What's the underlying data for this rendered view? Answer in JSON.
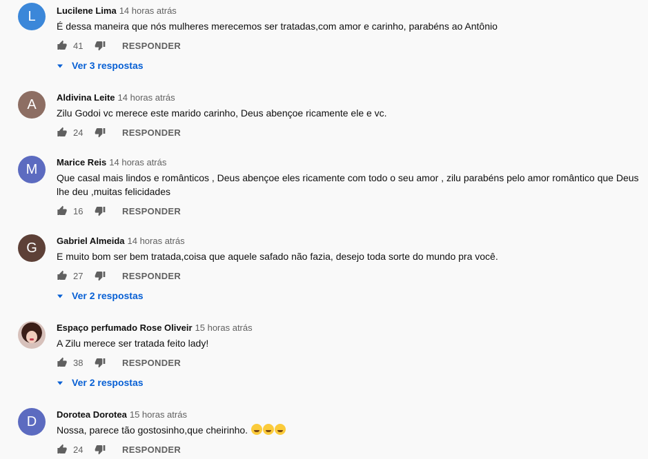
{
  "comments": [
    {
      "avatar_letter": "L",
      "avatar_color": "#3b87d9",
      "author": "Lucilene Lima",
      "time": "14 horas atrás",
      "text": "É dessa maneira que nós mulheres merecemos ser tratadas,com amor e carinho, parabéns ao Antônio",
      "likes": "41",
      "reply_label": "RESPONDER",
      "replies_label": "Ver 3 respostas"
    },
    {
      "avatar_letter": "A",
      "avatar_color": "#8d6e63",
      "author": "Aldivina Leite",
      "time": "14 horas atrás",
      "text": "Zilu Godoi vc merece este marido carinho, Deus abençoe ricamente ele e vc.",
      "likes": "24",
      "reply_label": "RESPONDER"
    },
    {
      "avatar_letter": "M",
      "avatar_color": "#5c6bc0",
      "author": "Marice Reis",
      "time": "14 horas atrás",
      "text": "Que casal mais lindos e românticos , Deus abençoe eles ricamente com todo o seu amor , zilu parabéns pelo amor romântico que Deus lhe deu ,muitas felicidades",
      "likes": "16",
      "reply_label": "RESPONDER"
    },
    {
      "avatar_letter": "G",
      "avatar_color": "#5d4037",
      "author": "Gabriel Almeida",
      "time": "14 horas atrás",
      "text": "E muito bom ser bem tratada,coisa que aquele safado não fazia, desejo toda sorte do mundo pra você.",
      "likes": "27",
      "reply_label": "RESPONDER",
      "replies_label": "Ver 2 respostas"
    },
    {
      "avatar_letter": "",
      "avatar_color": "#d7c1bb",
      "author": "Espaço perfumado Rose Oliveir",
      "time": "15 horas atrás",
      "text": "A Zilu merece ser tratada feito lady!",
      "likes": "38",
      "reply_label": "RESPONDER",
      "replies_label": "Ver 2 respostas"
    },
    {
      "avatar_letter": "D",
      "avatar_color": "#5c6bc0",
      "author": "Dorotea Dorotea",
      "time": "15 horas atrás",
      "text": "Nossa, parece tão gostosinho,que cheirinho.",
      "emoji_count": 3,
      "likes": "24",
      "reply_label": "RESPONDER"
    }
  ],
  "colors": {
    "background": "#f9f9f9",
    "link_blue": "#065fd4",
    "meta_gray": "#606060"
  }
}
